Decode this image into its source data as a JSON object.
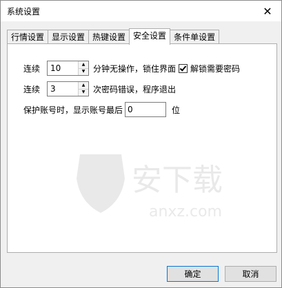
{
  "window": {
    "title": "系统设置",
    "close_symbol": "✕"
  },
  "tabs": [
    {
      "label": "行情设置",
      "active": false
    },
    {
      "label": "显示设置",
      "active": false
    },
    {
      "label": "热键设置",
      "active": false
    },
    {
      "label": "安全设置",
      "active": true
    },
    {
      "label": "条件单设置",
      "active": false
    }
  ],
  "security": {
    "row1": {
      "prefix": "连续",
      "minutes": "10",
      "suffix": "分钟无操作，锁住界面",
      "checkbox_label": "解锁需要密码",
      "checkbox_checked": true
    },
    "row2": {
      "prefix": "连续",
      "count": "3",
      "suffix": "次密码错误，程序退出"
    },
    "row3": {
      "prefix": "保护账号时，显示账号最后",
      "digits": "0",
      "suffix": "位"
    }
  },
  "buttons": {
    "ok": "确定",
    "cancel": "取消"
  },
  "watermark": {
    "text": "安下载",
    "domain": "anxz.com"
  }
}
